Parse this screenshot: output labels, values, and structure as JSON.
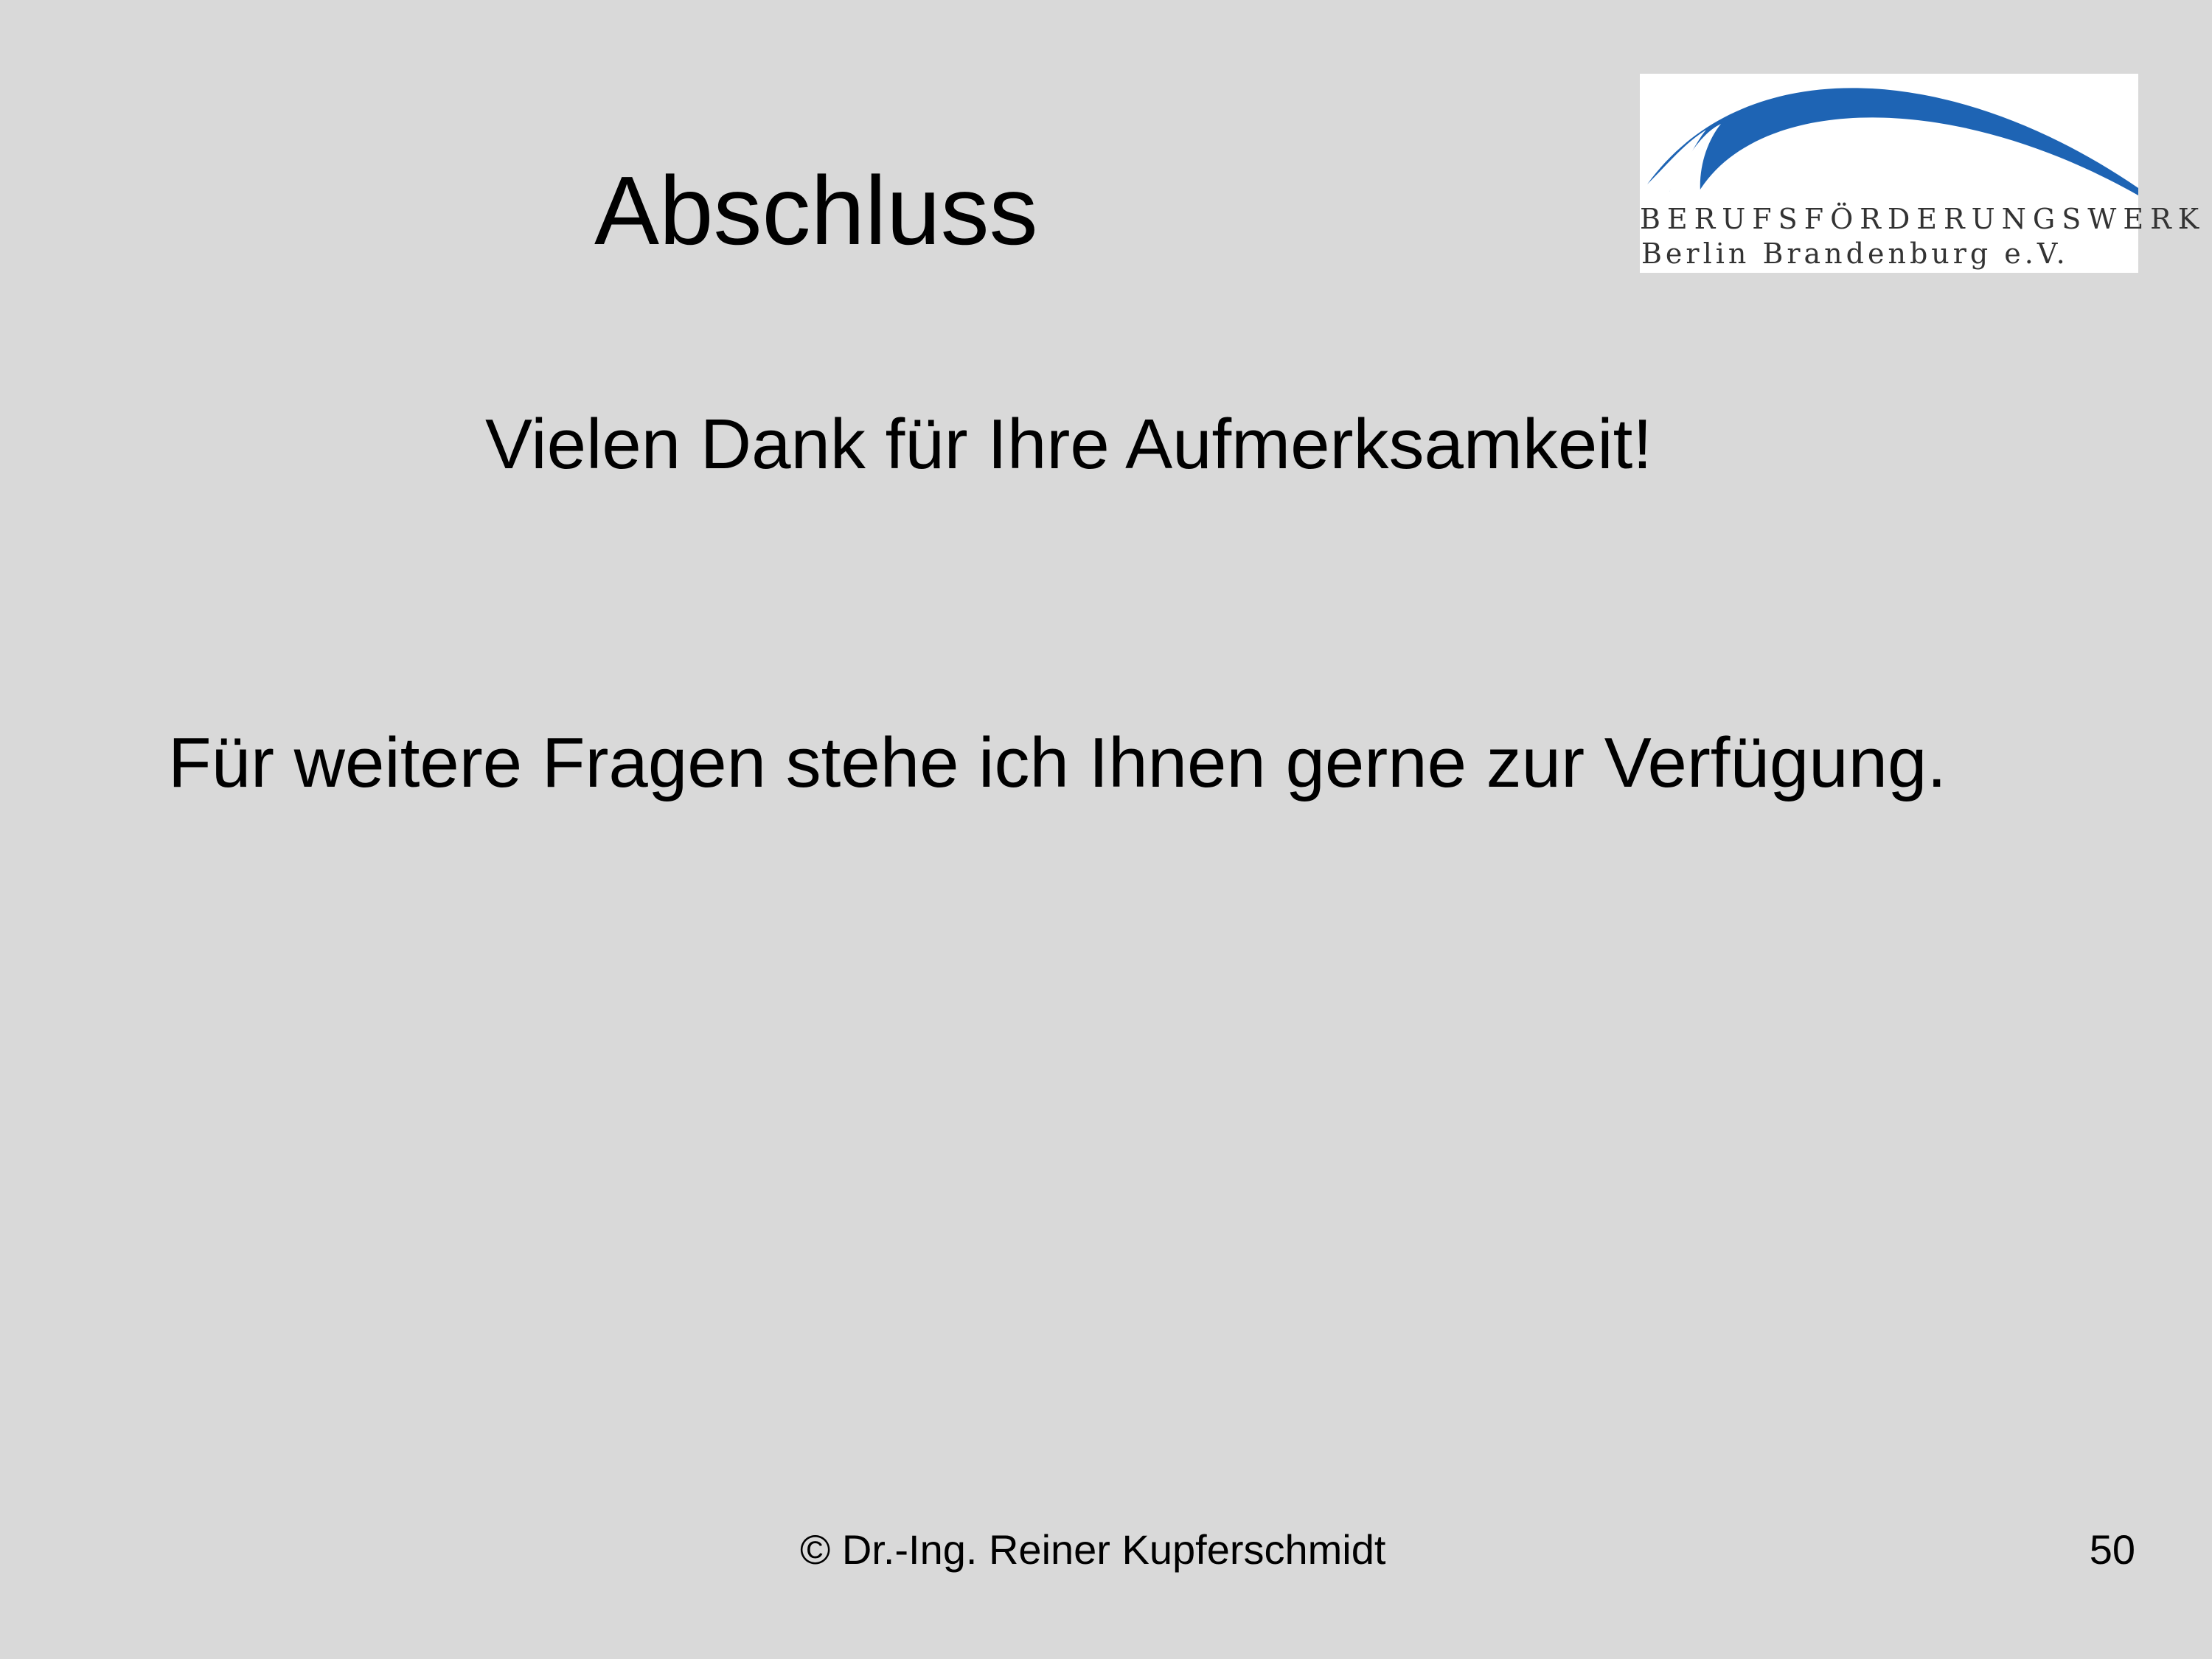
{
  "slide": {
    "title": "Abschluss",
    "thanks": "Vielen Dank für Ihre Aufmerksamkeit!",
    "questions": "Für weitere Fragen stehe ich Ihnen gerne zur Verfügung.",
    "footer": {
      "copyright": "© Dr.-Ing. Reiner Kupferschmidt",
      "page_number": "50"
    }
  },
  "logo": {
    "line1": "BERUFSFÖRDERUNGSWERK",
    "line2": "Berlin Brandenburg e.V.",
    "arc_color": "#1e64b4",
    "text_color": "#333333"
  },
  "colors": {
    "background": "#d9d9d9",
    "text": "#000000"
  }
}
